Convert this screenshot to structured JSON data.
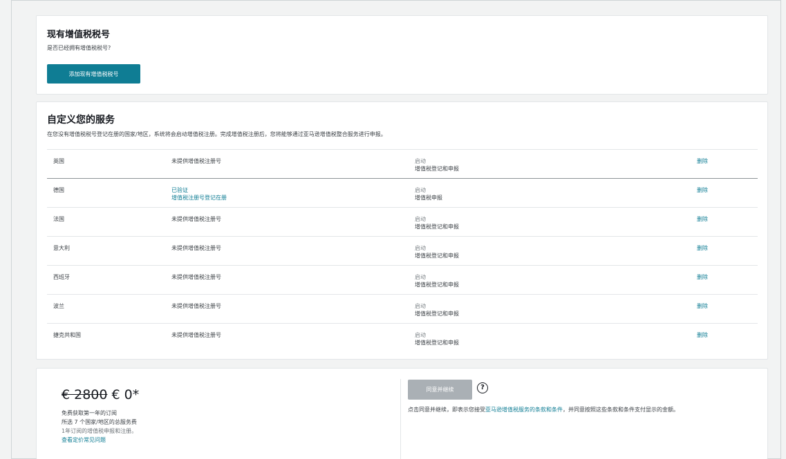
{
  "existing_vat": {
    "title": "现有增值税税号",
    "question": "是否已经拥有增值税税号?",
    "add_button": "添加现有增值税税号"
  },
  "customize": {
    "title": "自定义您的服务",
    "description": "在您没有增值税税号登记在册的国家/地区，系统将会启动增值税注册。完成增值税注册后，您将能够通过亚马逊增值税整合服务进行申报。",
    "rows": [
      {
        "country": "英国",
        "status": [
          "未提供增值税注册号"
        ],
        "verified": false,
        "service_status": "启动",
        "service": "增值税登记和申报",
        "delete": "删除"
      },
      {
        "country": "德国",
        "status": [
          "已验证",
          "增值税注册号登记在册"
        ],
        "verified": true,
        "service_status": "启动",
        "service": "增值税申报",
        "delete": "删除"
      },
      {
        "country": "法国",
        "status": [
          "未提供增值税注册号"
        ],
        "verified": false,
        "service_status": "启动",
        "service": "增值税登记和申报",
        "delete": "删除"
      },
      {
        "country": "意大利",
        "status": [
          "未提供增值税注册号"
        ],
        "verified": false,
        "service_status": "启动",
        "service": "增值税登记和申报",
        "delete": "删除"
      },
      {
        "country": "西班牙",
        "status": [
          "未提供增值税注册号"
        ],
        "verified": false,
        "service_status": "启动",
        "service": "增值税登记和申报",
        "delete": "删除"
      },
      {
        "country": "波兰",
        "status": [
          "未提供增值税注册号"
        ],
        "verified": false,
        "service_status": "启动",
        "service": "增值税登记和申报",
        "delete": "删除"
      },
      {
        "country": "捷克共和国",
        "status": [
          "未提供增值税注册号"
        ],
        "verified": false,
        "service_status": "启动",
        "service": "增值税登记和申报",
        "delete": "删除"
      }
    ]
  },
  "pricing": {
    "old_price": "€ 2800",
    "new_price": "€ 0*",
    "line1": "免费获取第一年的订阅",
    "line2": "所选 7 个国家/地区的总服务费",
    "line3": "1年订阅的增值税申报和注册。",
    "faq_link": "查看定价常见问题",
    "agree_button": "同意并继续",
    "help_icon": "question-circle-icon",
    "agree_prefix": "点击同意并继续，即表示您接受",
    "agree_link": "亚马逊增值税服务的条款和条件",
    "agree_suffix": "，并同意按照这些条款和条件支付显示的金额。"
  }
}
